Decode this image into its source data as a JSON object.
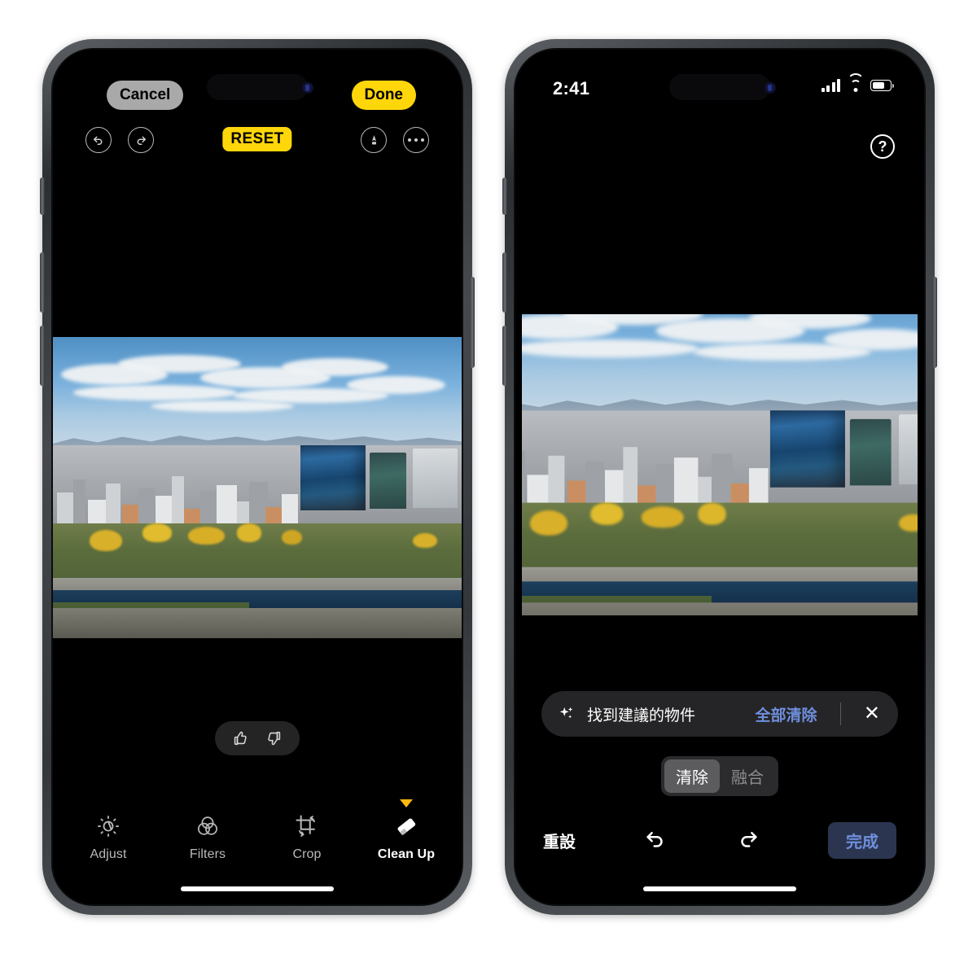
{
  "left_phone": {
    "top_bar": {
      "cancel_label": "Cancel",
      "done_label": "Done"
    },
    "edit_bar": {
      "undo_icon": "undo-circle-icon",
      "redo_icon": "redo-circle-icon",
      "reset_label": "RESET",
      "markup_icon": "markup-pen-icon",
      "more_icon": "more-ellipsis-icon"
    },
    "photo": {
      "alt": "Aerial cityscape of Osaka with skyscrapers, autumn park and castle moat"
    },
    "feedback": {
      "thumbs_up_icon": "thumbs-up-icon",
      "thumbs_down_icon": "thumbs-down-icon"
    },
    "tools": [
      {
        "label": "Adjust",
        "icon": "adjust-dial-icon",
        "active": false,
        "badge": false
      },
      {
        "label": "Filters",
        "icon": "filters-circles-icon",
        "active": false,
        "badge": false
      },
      {
        "label": "Crop",
        "icon": "crop-rotate-icon",
        "active": false,
        "badge": false
      },
      {
        "label": "Clean Up",
        "icon": "eraser-icon",
        "active": true,
        "badge": true
      }
    ]
  },
  "right_phone": {
    "status_bar": {
      "time": "2:41",
      "cellular_icon": "cellular-signal-icon",
      "wifi_icon": "wifi-icon",
      "battery_icon": "battery-icon"
    },
    "help_button": {
      "label": "?",
      "icon": "help-question-icon"
    },
    "suggestion_bar": {
      "sparkle_icon": "sparkles-icon",
      "text": "找到建議的物件",
      "clear_all_label": "全部清除",
      "close_icon": "close-x-icon"
    },
    "mode_segments": [
      {
        "label": "清除",
        "selected": true
      },
      {
        "label": "融合",
        "selected": false
      }
    ],
    "bottom_bar": {
      "reset_label": "重設",
      "undo_icon": "undo-arrow-icon",
      "redo_icon": "redo-arrow-icon",
      "done_label": "完成"
    }
  },
  "colors": {
    "accent_yellow": "#ffd60a",
    "accent_blue": "#6f8fdc",
    "done_button_bg": "#2b3550",
    "cancel_button_bg": "#a9a9a9",
    "badge_orange": "#ffb90f",
    "screen_black": "#000000"
  }
}
